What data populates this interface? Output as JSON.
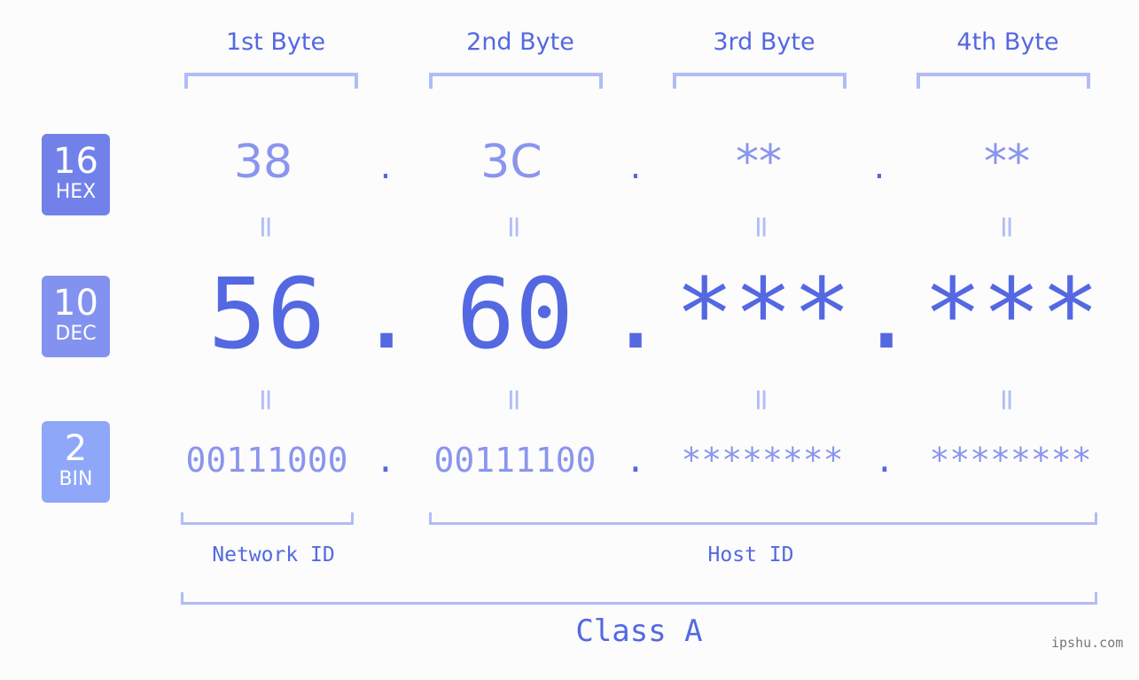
{
  "byte_headers": [
    "1st Byte",
    "2nd Byte",
    "3rd Byte",
    "4th Byte"
  ],
  "badges": [
    {
      "num": "16",
      "label": "HEX",
      "color": "#7281ea"
    },
    {
      "num": "10",
      "label": "DEC",
      "color": "#8392f0"
    },
    {
      "num": "2",
      "label": "BIN",
      "color": "#8ea7f8"
    }
  ],
  "hex": [
    "38",
    "3C",
    "**",
    "**"
  ],
  "dec": [
    "56",
    "60",
    "***",
    "***"
  ],
  "bin": [
    "00111000",
    "00111100",
    "********",
    "********"
  ],
  "separator": ".",
  "equals": "=",
  "segments": {
    "network": "Network ID",
    "host": "Host ID"
  },
  "class_label": "Class A",
  "watermark": "ipshu.com",
  "colors": {
    "primary": "#5468e2",
    "light": "#8a95ee",
    "bracket": "#b1bcf7"
  }
}
